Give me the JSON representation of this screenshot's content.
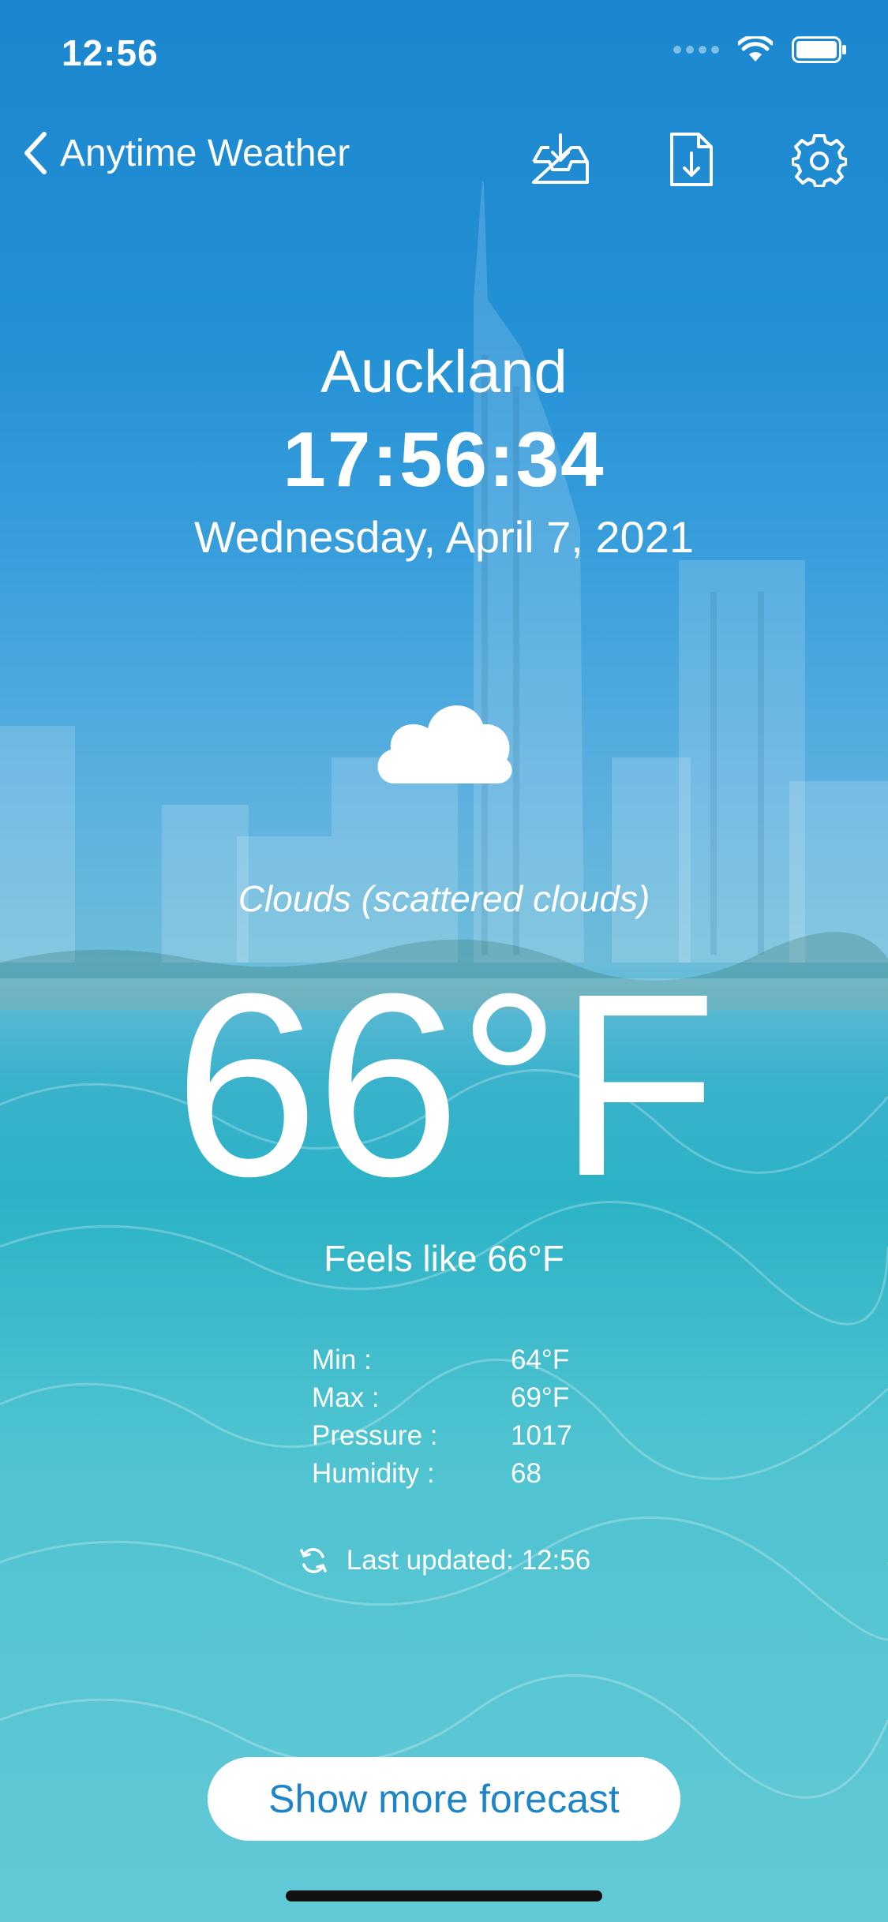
{
  "status_bar": {
    "time": "12:56"
  },
  "nav": {
    "back_label": "Anytime Weather"
  },
  "weather": {
    "city": "Auckland",
    "local_time": "17:56:34",
    "date": "Wednesday, April 7, 2021",
    "condition": "Clouds (scattered clouds)",
    "temperature": "66°F",
    "feels_like": "Feels like 66°F",
    "details": [
      {
        "label": "Min :",
        "value": "64°F"
      },
      {
        "label": "Max :",
        "value": "69°F"
      },
      {
        "label": "Pressure :",
        "value": "1017"
      },
      {
        "label": "Humidity :",
        "value": "68"
      }
    ],
    "last_updated": "Last updated: 12:56"
  },
  "actions": {
    "forecast_button": "Show more forecast"
  },
  "icons": {
    "back": "chevron-left-icon",
    "inbox": "inbox-download-icon",
    "file": "file-download-icon",
    "settings": "gear-icon",
    "weather": "cloud-icon",
    "refresh": "refresh-icon"
  },
  "colors": {
    "accent": "#1e84c8",
    "sky": "#1a86cf",
    "water": "#2bb2c6"
  }
}
